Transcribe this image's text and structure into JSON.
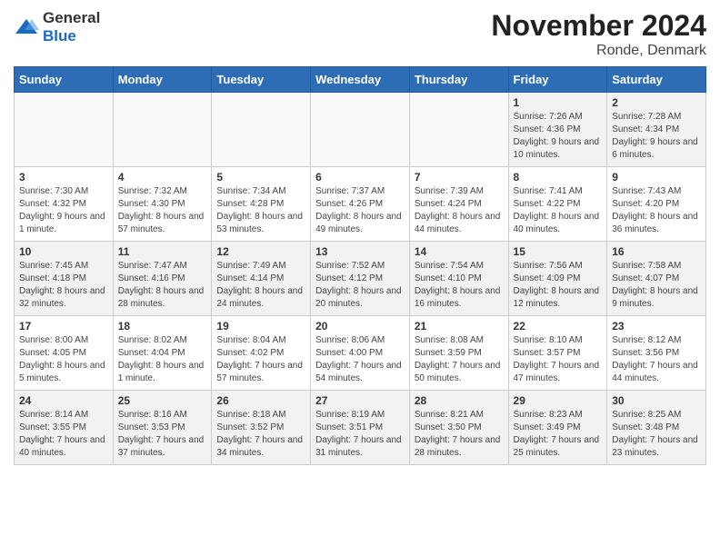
{
  "logo": {
    "text_general": "General",
    "text_blue": "Blue"
  },
  "header": {
    "month_title": "November 2024",
    "location": "Ronde, Denmark"
  },
  "days_of_week": [
    "Sunday",
    "Monday",
    "Tuesday",
    "Wednesday",
    "Thursday",
    "Friday",
    "Saturday"
  ],
  "weeks": [
    [
      {
        "day": "",
        "info": ""
      },
      {
        "day": "",
        "info": ""
      },
      {
        "day": "",
        "info": ""
      },
      {
        "day": "",
        "info": ""
      },
      {
        "day": "",
        "info": ""
      },
      {
        "day": "1",
        "info": "Sunrise: 7:26 AM\nSunset: 4:36 PM\nDaylight: 9 hours and 10 minutes."
      },
      {
        "day": "2",
        "info": "Sunrise: 7:28 AM\nSunset: 4:34 PM\nDaylight: 9 hours and 6 minutes."
      }
    ],
    [
      {
        "day": "3",
        "info": "Sunrise: 7:30 AM\nSunset: 4:32 PM\nDaylight: 9 hours and 1 minute."
      },
      {
        "day": "4",
        "info": "Sunrise: 7:32 AM\nSunset: 4:30 PM\nDaylight: 8 hours and 57 minutes."
      },
      {
        "day": "5",
        "info": "Sunrise: 7:34 AM\nSunset: 4:28 PM\nDaylight: 8 hours and 53 minutes."
      },
      {
        "day": "6",
        "info": "Sunrise: 7:37 AM\nSunset: 4:26 PM\nDaylight: 8 hours and 49 minutes."
      },
      {
        "day": "7",
        "info": "Sunrise: 7:39 AM\nSunset: 4:24 PM\nDaylight: 8 hours and 44 minutes."
      },
      {
        "day": "8",
        "info": "Sunrise: 7:41 AM\nSunset: 4:22 PM\nDaylight: 8 hours and 40 minutes."
      },
      {
        "day": "9",
        "info": "Sunrise: 7:43 AM\nSunset: 4:20 PM\nDaylight: 8 hours and 36 minutes."
      }
    ],
    [
      {
        "day": "10",
        "info": "Sunrise: 7:45 AM\nSunset: 4:18 PM\nDaylight: 8 hours and 32 minutes."
      },
      {
        "day": "11",
        "info": "Sunrise: 7:47 AM\nSunset: 4:16 PM\nDaylight: 8 hours and 28 minutes."
      },
      {
        "day": "12",
        "info": "Sunrise: 7:49 AM\nSunset: 4:14 PM\nDaylight: 8 hours and 24 minutes."
      },
      {
        "day": "13",
        "info": "Sunrise: 7:52 AM\nSunset: 4:12 PM\nDaylight: 8 hours and 20 minutes."
      },
      {
        "day": "14",
        "info": "Sunrise: 7:54 AM\nSunset: 4:10 PM\nDaylight: 8 hours and 16 minutes."
      },
      {
        "day": "15",
        "info": "Sunrise: 7:56 AM\nSunset: 4:09 PM\nDaylight: 8 hours and 12 minutes."
      },
      {
        "day": "16",
        "info": "Sunrise: 7:58 AM\nSunset: 4:07 PM\nDaylight: 8 hours and 9 minutes."
      }
    ],
    [
      {
        "day": "17",
        "info": "Sunrise: 8:00 AM\nSunset: 4:05 PM\nDaylight: 8 hours and 5 minutes."
      },
      {
        "day": "18",
        "info": "Sunrise: 8:02 AM\nSunset: 4:04 PM\nDaylight: 8 hours and 1 minute."
      },
      {
        "day": "19",
        "info": "Sunrise: 8:04 AM\nSunset: 4:02 PM\nDaylight: 7 hours and 57 minutes."
      },
      {
        "day": "20",
        "info": "Sunrise: 8:06 AM\nSunset: 4:00 PM\nDaylight: 7 hours and 54 minutes."
      },
      {
        "day": "21",
        "info": "Sunrise: 8:08 AM\nSunset: 3:59 PM\nDaylight: 7 hours and 50 minutes."
      },
      {
        "day": "22",
        "info": "Sunrise: 8:10 AM\nSunset: 3:57 PM\nDaylight: 7 hours and 47 minutes."
      },
      {
        "day": "23",
        "info": "Sunrise: 8:12 AM\nSunset: 3:56 PM\nDaylight: 7 hours and 44 minutes."
      }
    ],
    [
      {
        "day": "24",
        "info": "Sunrise: 8:14 AM\nSunset: 3:55 PM\nDaylight: 7 hours and 40 minutes."
      },
      {
        "day": "25",
        "info": "Sunrise: 8:16 AM\nSunset: 3:53 PM\nDaylight: 7 hours and 37 minutes."
      },
      {
        "day": "26",
        "info": "Sunrise: 8:18 AM\nSunset: 3:52 PM\nDaylight: 7 hours and 34 minutes."
      },
      {
        "day": "27",
        "info": "Sunrise: 8:19 AM\nSunset: 3:51 PM\nDaylight: 7 hours and 31 minutes."
      },
      {
        "day": "28",
        "info": "Sunrise: 8:21 AM\nSunset: 3:50 PM\nDaylight: 7 hours and 28 minutes."
      },
      {
        "day": "29",
        "info": "Sunrise: 8:23 AM\nSunset: 3:49 PM\nDaylight: 7 hours and 25 minutes."
      },
      {
        "day": "30",
        "info": "Sunrise: 8:25 AM\nSunset: 3:48 PM\nDaylight: 7 hours and 23 minutes."
      }
    ]
  ]
}
